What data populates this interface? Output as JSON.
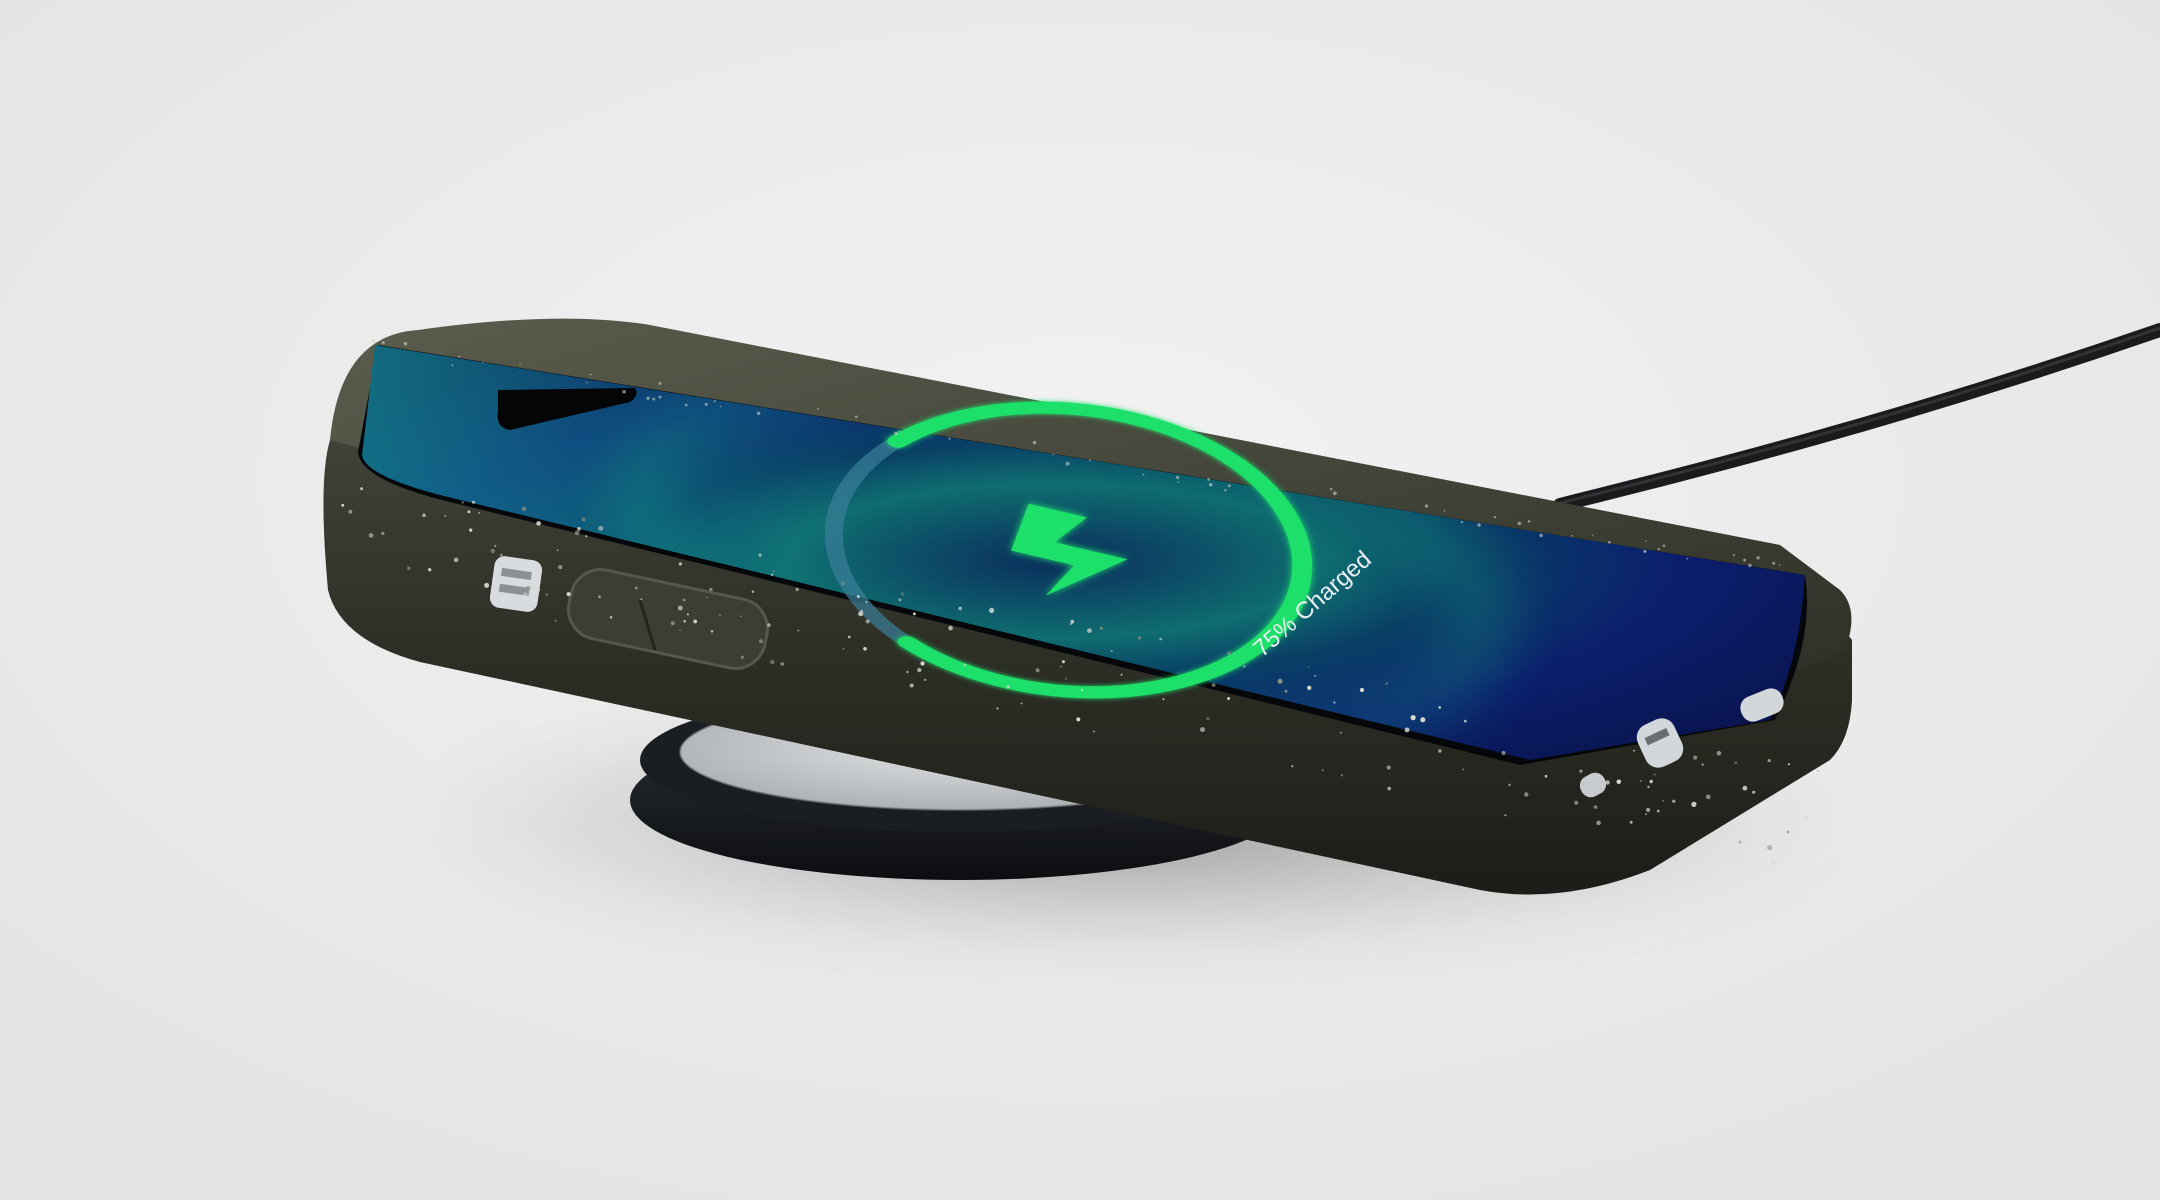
{
  "screen": {
    "charge_percent": 75,
    "charge_label": "75% Charged"
  },
  "colors": {
    "background": "#e9ebea",
    "case_body": "#2f3128",
    "case_rim": "#3f4236",
    "ring_green": "#1fe06a",
    "ring_track": "#3a7f99",
    "screen_deep_blue": "#0b1e6e",
    "screen_teal": "#0f6d70",
    "pad_dark": "#15181c",
    "pad_fabric": "#cfd2d4",
    "cable": "#1a1b1d"
  }
}
